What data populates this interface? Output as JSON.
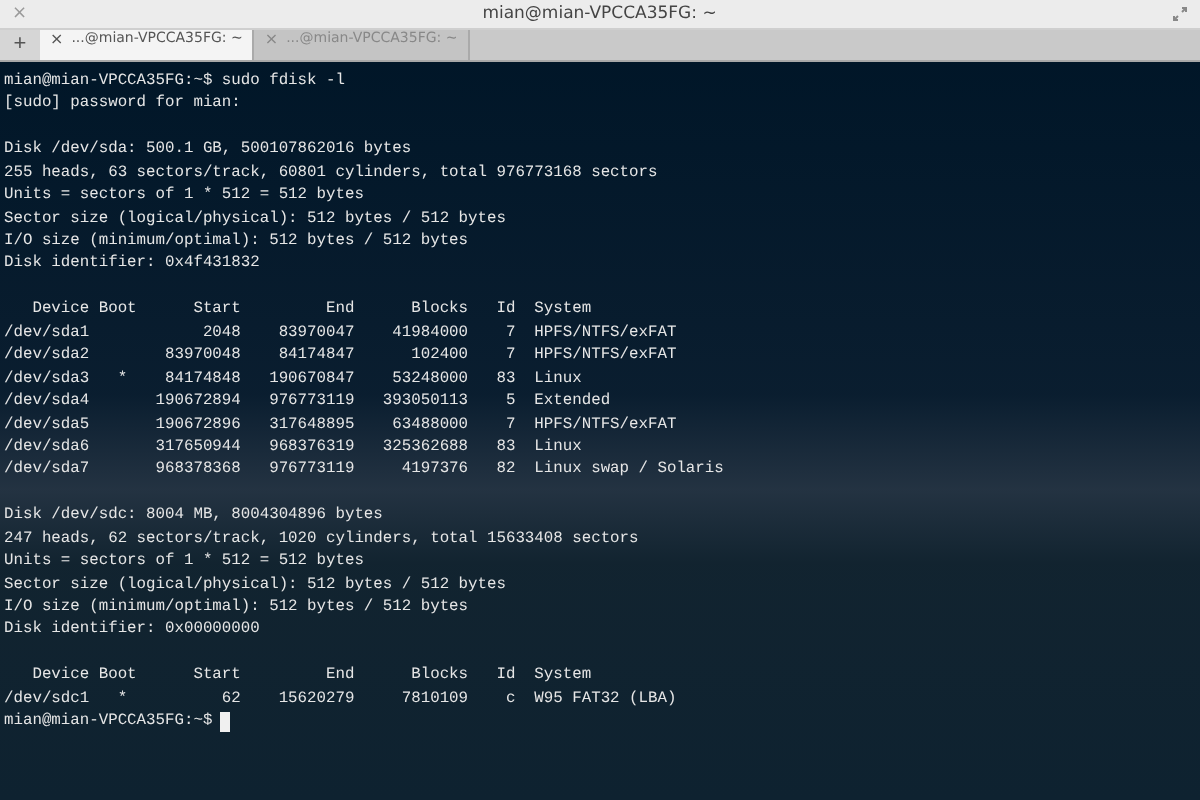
{
  "window": {
    "title": "mian@mian-VPCCA35FG: ~",
    "close": "×"
  },
  "tabs": [
    {
      "label": "...@mian-VPCCA35FG: ~",
      "close": "×",
      "selected": true
    },
    {
      "label": "...@mian-VPCCA35FG: ~",
      "close": "×",
      "selected": false
    }
  ],
  "new_tab": "+",
  "terminal": {
    "blocks": [
      [
        "mian@mian-VPCCA35FG:~$ sudo fdisk -l",
        "[sudo] password for mian:"
      ],
      [
        "Disk /dev/sda: 500.1 GB, 500107862016 bytes",
        "255 heads, 63 sectors/track, 60801 cylinders, total 976773168 sectors",
        "Units = sectors of 1 * 512 = 512 bytes",
        "Sector size (logical/physical): 512 bytes / 512 bytes",
        "I/O size (minimum/optimal): 512 bytes / 512 bytes",
        "Disk identifier: 0x4f431832"
      ],
      [
        "   Device Boot      Start         End      Blocks   Id  System",
        "/dev/sda1            2048    83970047    41984000    7  HPFS/NTFS/exFAT",
        "/dev/sda2        83970048    84174847      102400    7  HPFS/NTFS/exFAT",
        "/dev/sda3   *    84174848   190670847    53248000   83  Linux",
        "/dev/sda4       190672894   976773119   393050113    5  Extended",
        "/dev/sda5       190672896   317648895    63488000    7  HPFS/NTFS/exFAT",
        "/dev/sda6       317650944   968376319   325362688   83  Linux",
        "/dev/sda7       968378368   976773119     4197376   82  Linux swap / Solaris"
      ],
      [
        "Disk /dev/sdc: 8004 MB, 8004304896 bytes",
        "247 heads, 62 sectors/track, 1020 cylinders, total 15633408 sectors",
        "Units = sectors of 1 * 512 = 512 bytes",
        "Sector size (logical/physical): 512 bytes / 512 bytes",
        "I/O size (minimum/optimal): 512 bytes / 512 bytes",
        "Disk identifier: 0x00000000"
      ],
      [
        "   Device Boot      Start         End      Blocks   Id  System",
        "/dev/sdc1   *          62    15620279     7810109    c  W95 FAT32 (LBA)"
      ]
    ],
    "prompt": "mian@mian-VPCCA35FG:~$",
    "cursor": true
  }
}
